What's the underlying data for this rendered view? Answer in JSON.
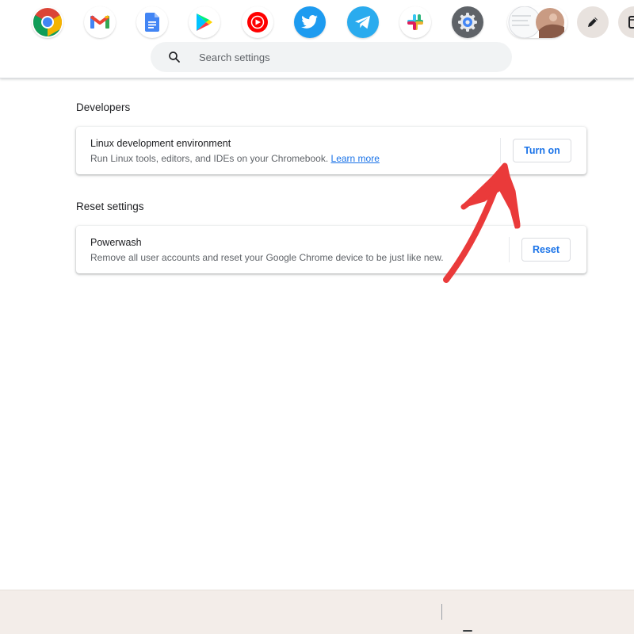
{
  "search": {
    "placeholder": "Search settings"
  },
  "developers": {
    "title": "Developers",
    "card": {
      "title": "Linux development environment",
      "subtitle": "Run Linux tools, editors, and IDEs on your Chromebook.",
      "link": "Learn more",
      "button": "Turn on"
    }
  },
  "reset": {
    "title": "Reset settings",
    "card": {
      "title": "Powerwash",
      "subtitle": "Remove all user accounts and reset your Google Chrome device to be just like new.",
      "button": "Reset"
    }
  },
  "annotation": {
    "type": "arrow",
    "color": "#ea3a3a",
    "points_to": "Turn on"
  },
  "shelf": {
    "apps": [
      {
        "icon": "chrome-icon"
      },
      {
        "icon": "gmail-icon"
      },
      {
        "icon": "docs-icon"
      },
      {
        "icon": "play-store-icon"
      },
      {
        "icon": "youtube-music-icon"
      },
      {
        "icon": "twitter-icon"
      },
      {
        "icon": "telegram-icon"
      },
      {
        "icon": "slack-icon"
      },
      {
        "icon": "settings-icon",
        "active": true
      },
      {
        "icon": "browser-windows-thumbnail"
      },
      {
        "icon": "stylus-pen-icon"
      },
      {
        "icon": "tote-icon"
      }
    ]
  },
  "colors": {
    "accent": "#1a73e8",
    "annotation": "#ea3a3a",
    "shelf": "#f3ede9"
  }
}
